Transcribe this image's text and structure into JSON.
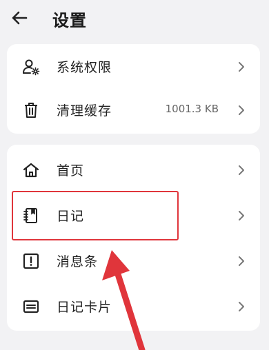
{
  "header": {
    "title": "设置",
    "back_icon": "arrow-left-icon"
  },
  "section1": {
    "items": [
      {
        "label": "系统权限",
        "icon": "user-settings-icon"
      },
      {
        "label": "清理缓存",
        "icon": "trash-icon",
        "value": "1001.3 KB"
      }
    ]
  },
  "section2": {
    "items": [
      {
        "label": "首页",
        "icon": "home-icon"
      },
      {
        "label": "日记",
        "icon": "notebook-icon"
      },
      {
        "label": "消息条",
        "icon": "alert-box-icon"
      },
      {
        "label": "日记卡片",
        "icon": "card-icon"
      }
    ]
  },
  "annotation": {
    "highlight_color": "#e0353b",
    "arrow_color": "#e0353b"
  }
}
